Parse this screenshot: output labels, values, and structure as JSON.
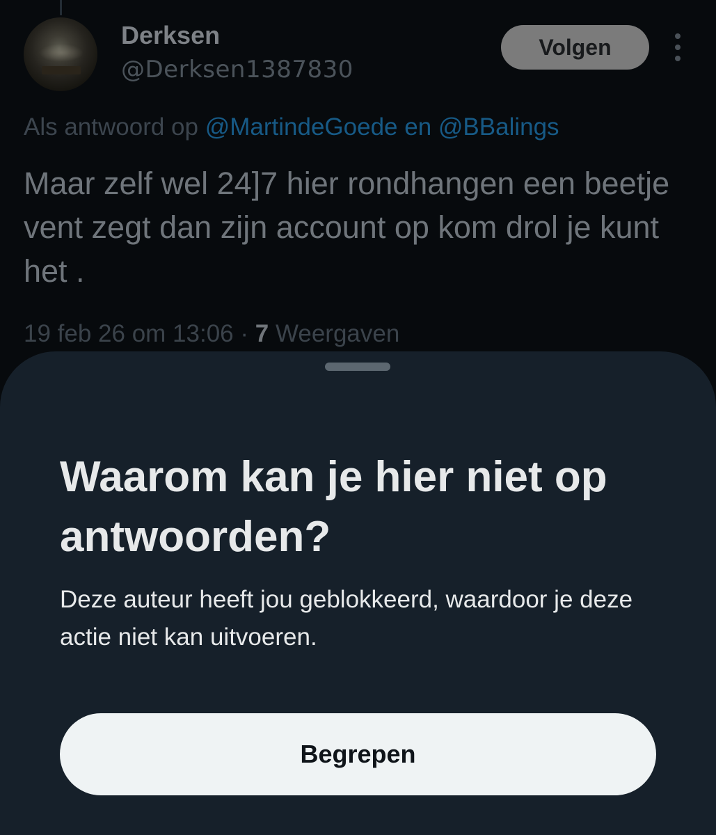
{
  "tweet": {
    "display_name": "Derksen",
    "handle": "@Derksen1387830",
    "follow_label": "Volgen",
    "reply_prefix": "Als antwoord op",
    "reply_mentions": "@MartindeGoede en @BBalings",
    "text": "Maar zelf wel 24]7 hier rondhangen een beetje vent zegt dan zijn account op kom drol je kunt het .",
    "timestamp": "19 feb 26 om 13:06",
    "separator": "·",
    "views_count": "7",
    "views_label": "Weergaven"
  },
  "sheet": {
    "title": "Waarom kan je hier niet op antwoorden?",
    "body": "Deze auteur heeft jou geblokkeerd, waardoor je deze actie niet kan uitvoeren.",
    "button_label": "Begrepen"
  },
  "icons": {
    "more": "more-vertical-icon"
  },
  "colors": {
    "sheet_background": "#16202a",
    "mention_link": "#1d9bf0",
    "primary_button": "#eff3f4"
  }
}
